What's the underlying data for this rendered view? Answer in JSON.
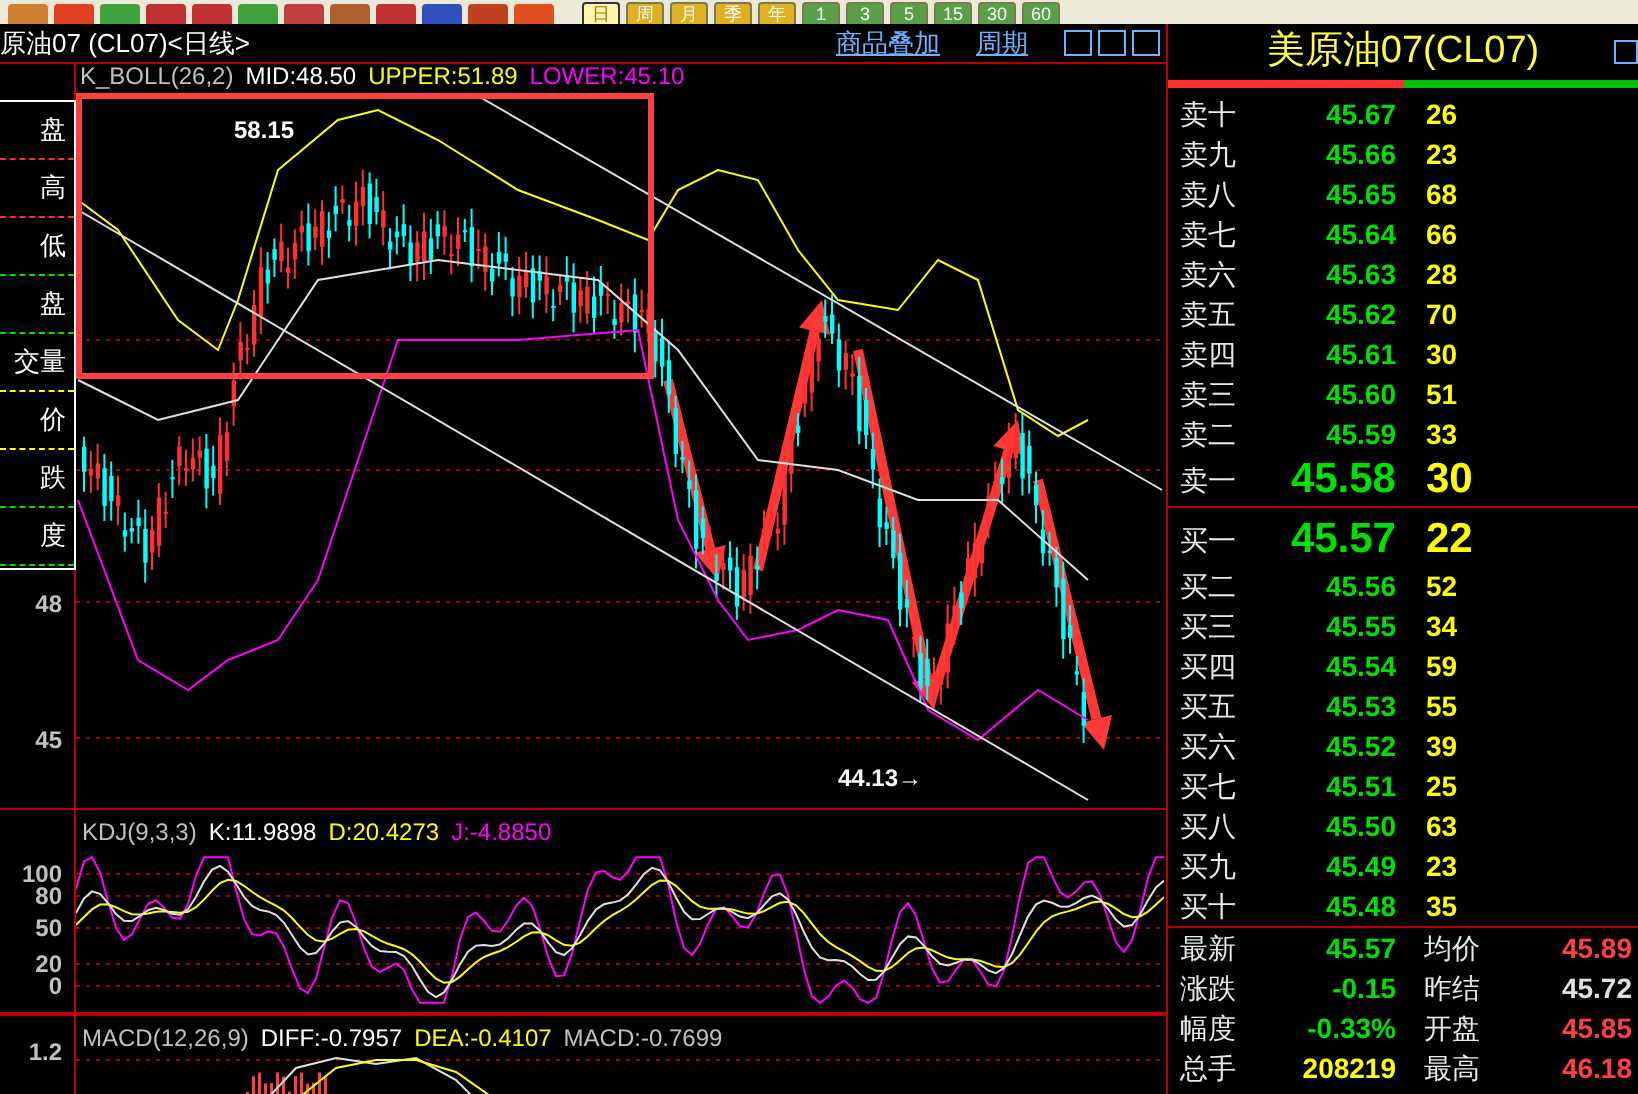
{
  "toolbar": {
    "tool_buttons": [
      {
        "color": "#d08030"
      },
      {
        "color": "#e04020"
      },
      {
        "color": "#40a040"
      },
      {
        "color": "#c03030"
      },
      {
        "color": "#c03030"
      },
      {
        "color": "#40a040"
      },
      {
        "color": "#c04040"
      },
      {
        "color": "#b06030"
      },
      {
        "color": "#c03030"
      },
      {
        "color": "#3050c0"
      },
      {
        "color": "#c04020"
      },
      {
        "color": "#e05020"
      }
    ],
    "period_buttons": [
      {
        "label": "日",
        "selected": true
      },
      {
        "label": "周",
        "selected": false
      },
      {
        "label": "月",
        "selected": false
      },
      {
        "label": "季",
        "selected": false
      },
      {
        "label": "年",
        "selected": false
      },
      {
        "label": "1",
        "selected": false
      },
      {
        "label": "3",
        "selected": false
      },
      {
        "label": "5",
        "selected": false
      },
      {
        "label": "15",
        "selected": false
      },
      {
        "label": "30",
        "selected": false
      },
      {
        "label": "60",
        "selected": false
      }
    ]
  },
  "chart_header": {
    "title": "原油07 (CL07)<日线>",
    "links": [
      "商品叠加",
      "周期"
    ]
  },
  "main_chart": {
    "legend": [
      {
        "text": "K_BOLL(26,2)",
        "color": "#c0c0c0"
      },
      {
        "text": "MID:48.50",
        "color": "#ffffff"
      },
      {
        "text": "UPPER:51.89",
        "color": "#ffff00"
      },
      {
        "text": "LOWER:45.10",
        "color": "#ff00ff"
      }
    ],
    "high_label": "58.15",
    "low_label": "44.13→",
    "y_axis": [
      {
        "label": "48"
      },
      {
        "label": "45"
      }
    ]
  },
  "info_panel": {
    "rows": [
      {
        "label": "盘",
        "color": "#ff3030"
      },
      {
        "label": "高",
        "color": "#ff3030"
      },
      {
        "label": "低",
        "color": "#00e000"
      },
      {
        "label": "盘",
        "color": "#00e000"
      },
      {
        "label": "交量",
        "color": "#ffff00"
      },
      {
        "label": "价",
        "color": "#ffff00"
      },
      {
        "label": "跌",
        "color": "#00e000"
      },
      {
        "label": "度",
        "color": "#00e000"
      }
    ]
  },
  "kdj": {
    "legend": [
      {
        "text": "KDJ(9,3,3)",
        "color": "#c0c0c0"
      },
      {
        "text": "K:11.9898",
        "color": "#ffffff"
      },
      {
        "text": "D:20.4273",
        "color": "#ffff00"
      },
      {
        "text": "J:-4.8850",
        "color": "#ff00ff"
      }
    ],
    "y_axis": [
      "100",
      "80",
      "50",
      "20",
      "0"
    ]
  },
  "macd": {
    "legend": [
      {
        "text": "MACD(12,26,9)",
        "color": "#c0c0c0"
      },
      {
        "text": "DIFF:-0.7957",
        "color": "#ffffff"
      },
      {
        "text": "DEA:-0.4107",
        "color": "#ffff00"
      },
      {
        "text": "MACD:-0.7699",
        "color": "#c0c0c0"
      }
    ],
    "y_axis": [
      "1.2"
    ]
  },
  "quote": {
    "title": "美原油07(CL07)",
    "ratio_bar": {
      "level": 0.5
    },
    "asks": [
      {
        "label": "卖十",
        "price": "45.67",
        "volume": "26"
      },
      {
        "label": "卖九",
        "price": "45.66",
        "volume": "23"
      },
      {
        "label": "卖八",
        "price": "45.65",
        "volume": "68"
      },
      {
        "label": "卖七",
        "price": "45.64",
        "volume": "66"
      },
      {
        "label": "卖六",
        "price": "45.63",
        "volume": "28"
      },
      {
        "label": "卖五",
        "price": "45.62",
        "volume": "70"
      },
      {
        "label": "卖四",
        "price": "45.61",
        "volume": "30"
      },
      {
        "label": "卖三",
        "price": "45.60",
        "volume": "51"
      },
      {
        "label": "卖二",
        "price": "45.59",
        "volume": "33"
      }
    ],
    "best_ask": {
      "label": "卖一",
      "price": "45.58",
      "volume": "30"
    },
    "best_bid": {
      "label": "买一",
      "price": "45.57",
      "volume": "22"
    },
    "bids": [
      {
        "label": "买二",
        "price": "45.56",
        "volume": "52"
      },
      {
        "label": "买三",
        "price": "45.55",
        "volume": "34"
      },
      {
        "label": "买四",
        "price": "45.54",
        "volume": "59"
      },
      {
        "label": "买五",
        "price": "45.53",
        "volume": "55"
      },
      {
        "label": "买六",
        "price": "45.52",
        "volume": "39"
      },
      {
        "label": "买七",
        "price": "45.51",
        "volume": "25"
      },
      {
        "label": "买八",
        "price": "45.50",
        "volume": "63"
      },
      {
        "label": "买九",
        "price": "45.49",
        "volume": "23"
      },
      {
        "label": "买十",
        "price": "45.48",
        "volume": "35"
      }
    ],
    "stats": [
      {
        "label": "最新",
        "value": "45.57",
        "color": "#00e000"
      },
      {
        "label": "均价",
        "value": "45.89",
        "color": "#ff4040"
      },
      {
        "label": "涨跌",
        "value": "-0.15",
        "color": "#00e000"
      },
      {
        "label": "昨结",
        "value": "45.72",
        "color": "#e0e0e0"
      },
      {
        "label": "幅度",
        "value": "-0.33%",
        "color": "#00e000"
      },
      {
        "label": "开盘",
        "value": "45.85",
        "color": "#ff4040"
      },
      {
        "label": "总手",
        "value": "208219",
        "color": "#ffff00"
      },
      {
        "label": "最高",
        "value": "46.18",
        "color": "#ff4040"
      }
    ]
  }
}
